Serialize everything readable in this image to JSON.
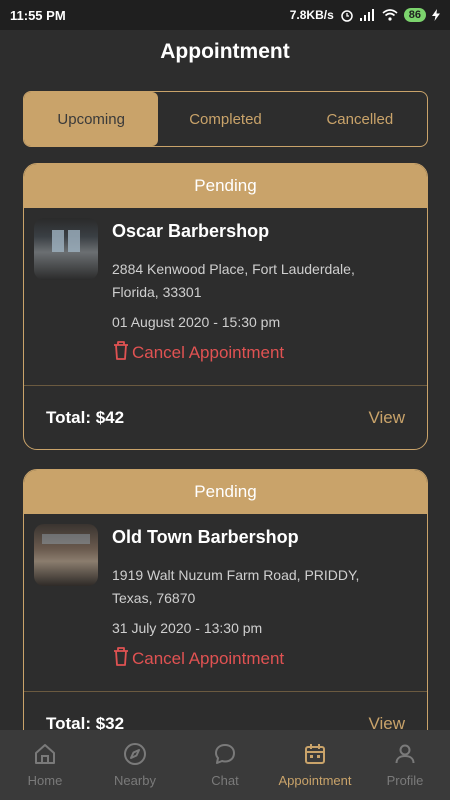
{
  "status": {
    "time": "11:55 PM",
    "speed": "7.8KB/s",
    "battery": "86"
  },
  "header": {
    "title": "Appointment"
  },
  "tabs": [
    {
      "label": "Upcoming"
    },
    {
      "label": "Completed"
    },
    {
      "label": "Cancelled"
    }
  ],
  "appointments": [
    {
      "status": "Pending",
      "shop_name": "Oscar Barbershop",
      "address_line1": "2884 Kenwood Place, Fort Lauderdale,",
      "address_line2": "Florida, 33301",
      "datetime": "01 August 2020 - 15:30 pm",
      "cancel_label": "Cancel Appointment",
      "total": "Total: $42",
      "view_label": "View"
    },
    {
      "status": "Pending",
      "shop_name": "Old Town Barbershop",
      "address_line1": "1919 Walt Nuzum Farm Road, PRIDDY,",
      "address_line2": "Texas, 76870",
      "datetime": "31 July 2020 - 13:30 pm",
      "cancel_label": "Cancel Appointment",
      "total": "Total: $32",
      "view_label": "View"
    }
  ],
  "nav": [
    {
      "label": "Home",
      "icon": "home-icon"
    },
    {
      "label": "Nearby",
      "icon": "compass-icon"
    },
    {
      "label": "Chat",
      "icon": "chat-icon"
    },
    {
      "label": "Appointment",
      "icon": "calendar-icon"
    },
    {
      "label": "Profile",
      "icon": "user-icon"
    }
  ],
  "colors": {
    "accent": "#c9a36a",
    "background": "#2d2d2d",
    "danger": "#e05252"
  }
}
